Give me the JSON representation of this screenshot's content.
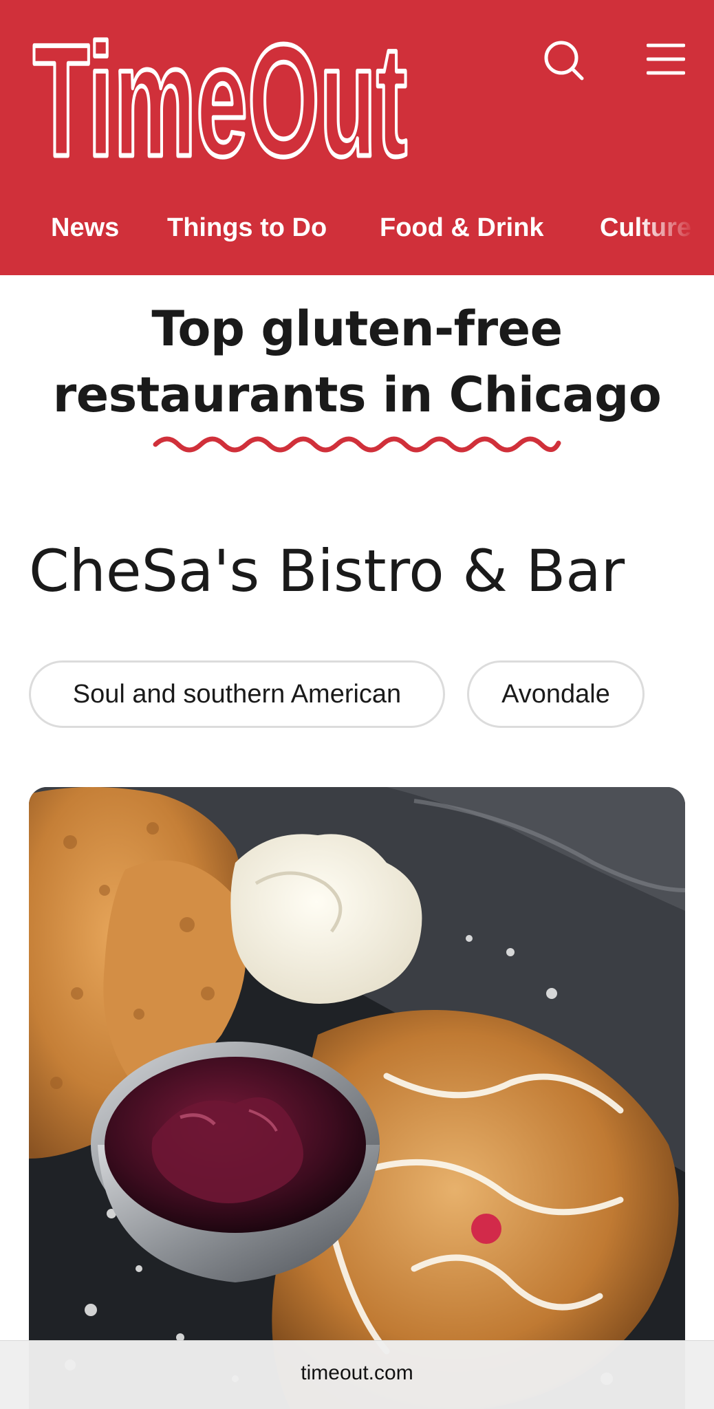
{
  "brand": {
    "name": "Time Out",
    "logo_text": "TimeOut",
    "color": "#d0303a"
  },
  "header": {
    "search_icon": "search-icon",
    "menu_icon": "hamburger-menu-icon"
  },
  "nav": {
    "items": [
      {
        "label": "News"
      },
      {
        "label": "Things to Do"
      },
      {
        "label": "Food & Drink"
      },
      {
        "label": "Culture"
      }
    ]
  },
  "article": {
    "title": "Top gluten-free restaurants in Chicago",
    "underline_color": "#d0303a"
  },
  "venue": {
    "name": "CheSa's Bistro & Bar",
    "tags": [
      "Soul and southern American",
      "Avondale"
    ],
    "photo": "food-photo"
  },
  "browser": {
    "url": "timeout.com"
  }
}
